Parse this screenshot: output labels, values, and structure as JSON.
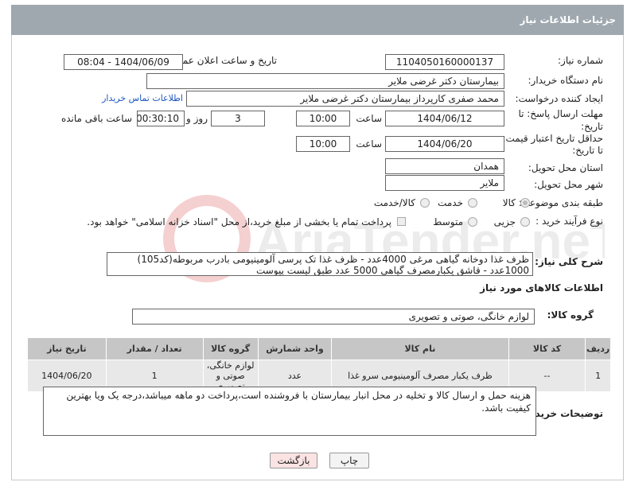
{
  "page_title": "جزئیات اطلاعات نیاز",
  "fields": {
    "need_number_label": "شماره نیاز:",
    "need_number": "1104050160000137",
    "announce_label": "تاریخ و ساعت اعلان عمومی:",
    "announce_value": "1404/06/09 - 08:04",
    "buyer_org_label": "نام دستگاه خریدار:",
    "buyer_org": "بیمارستان دکتر غرضی ملایر",
    "creator_label": "ایجاد کننده درخواست:",
    "creator": "محمد صفری کارپرداز بیمارستان دکتر غرضی ملایر",
    "contact_link": "اطلاعات تماس خریدار",
    "reply_deadline_label_1": "مهلت ارسال پاسخ: تا",
    "reply_deadline_label_2": "تاریخ:",
    "reply_date": "1404/06/12",
    "time_label": "ساعت",
    "reply_time": "10:00",
    "days_value": "3",
    "days_label": "روز و",
    "remaining_time": "00:30:10",
    "remaining_label": "ساعت باقی مانده",
    "price_validity_label_1": "حداقل تاریخ اعتبار قیمت:",
    "price_validity_label_2": "تا تاریخ:",
    "price_date": "1404/06/20",
    "price_time": "10:00",
    "province_label": "استان محل تحویل:",
    "province": "همدان",
    "city_label": "شهر محل تحویل:",
    "city": "ملایر",
    "category_label": "طبقه بندی موضوعی:",
    "category_options": [
      "کالا",
      "خدمت",
      "کالا/خدمت"
    ],
    "process_label": "نوع فرآیند خرید :",
    "process_options": [
      "جزیی",
      "متوسط"
    ],
    "payment_note": "پرداخت تمام یا بخشی از مبلغ خرید،از محل \"اسناد خزانه اسلامی\" خواهد بود."
  },
  "description": {
    "label": "شرح کلی نیاز:",
    "text": "ظرف غذا دوخانه گیاهی مرغی 4000عدد  -  ظرف غذا تک پرسی آلومینیومی بادرب مربوطه(کد105)  1000عدد - قاشق یکبارمصرف گیاهی 5000 عدد طبق لیست پیوست"
  },
  "goods_section_title": "اطلاعات کالاهای مورد نیاز",
  "goods_group_label": "گروه کالا:",
  "goods_group": "لوازم خانگی، صوتی و تصویری",
  "table": {
    "headers": [
      "ردیف",
      "کد کالا",
      "نام کالا",
      "واحد شمارش",
      "گروه کالا",
      "تعداد / مقدار",
      "تاریخ نیاز"
    ],
    "rows": [
      [
        "1",
        "--",
        "ظرف یکبار مصرف آلومینیومی سرو غذا",
        "عدد",
        "لوازم خانگی، صوتی و تصویری",
        "1",
        "1404/06/20"
      ]
    ]
  },
  "buyer_notes_label": "توضیحات خریدار:",
  "buyer_notes": "هزینه حمل و  ارسال کالا و تخلیه در محل انبار بیمارستان با فروشنده است،پرداخت دو ماهه میباشد،درجه یک ویا بهترین کیفیت باشد.",
  "buttons": {
    "print": "چاپ",
    "back": "بازگشت"
  },
  "watermark_text": "AriaTender.neT",
  "colors": {
    "header_bg": "#9fa8af",
    "print_bg": "#f3f3f3",
    "back_bg": "#fbe3e3"
  }
}
